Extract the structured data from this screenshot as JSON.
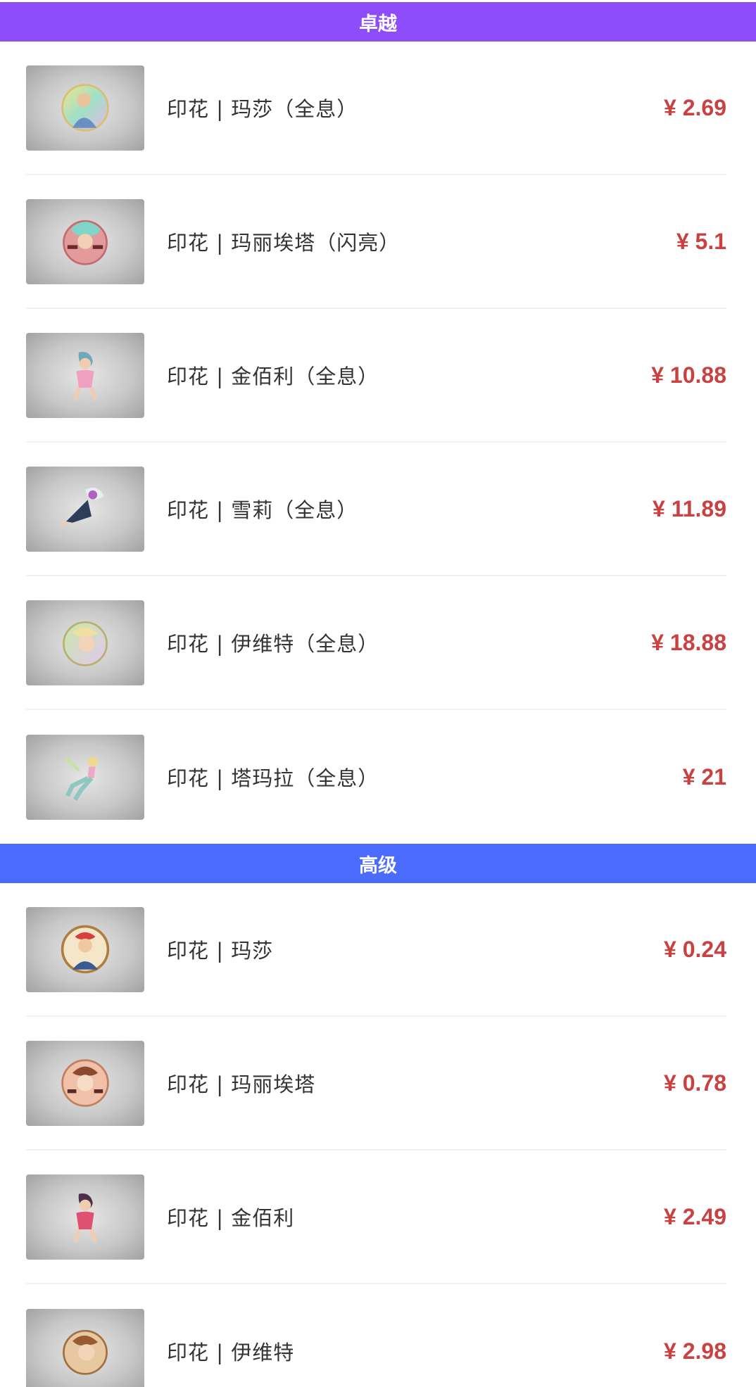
{
  "sections": [
    {
      "title": "卓越",
      "color": "#8e4dfa",
      "items": [
        {
          "name": "印花 | 玛莎（全息）",
          "price": "¥ 2.69",
          "icon": "sticker-holo-icon"
        },
        {
          "name": "印花 | 玛丽埃塔（闪亮）",
          "price": "¥ 5.1",
          "icon": "sticker-foil-icon"
        },
        {
          "name": "印花 | 金佰利（全息）",
          "price": "¥ 10.88",
          "icon": "sticker-holo-icon"
        },
        {
          "name": "印花 | 雪莉（全息）",
          "price": "¥ 11.89",
          "icon": "sticker-holo-icon"
        },
        {
          "name": "印花 | 伊维特（全息）",
          "price": "¥ 18.88",
          "icon": "sticker-holo-icon"
        },
        {
          "name": "印花 | 塔玛拉（全息）",
          "price": "¥ 21",
          "icon": "sticker-holo-icon"
        }
      ]
    },
    {
      "title": "高级",
      "color": "#4b6bff",
      "items": [
        {
          "name": "印花 | 玛莎",
          "price": "¥ 0.24",
          "icon": "sticker-icon"
        },
        {
          "name": "印花 | 玛丽埃塔",
          "price": "¥ 0.78",
          "icon": "sticker-icon"
        },
        {
          "name": "印花 | 金佰利",
          "price": "¥ 2.49",
          "icon": "sticker-icon"
        },
        {
          "name": "印花 | 伊维特",
          "price": "¥ 2.98",
          "icon": "sticker-icon"
        }
      ]
    }
  ],
  "colors": {
    "price": "#c94141",
    "text": "#333333",
    "divider": "#f2f2f2"
  }
}
